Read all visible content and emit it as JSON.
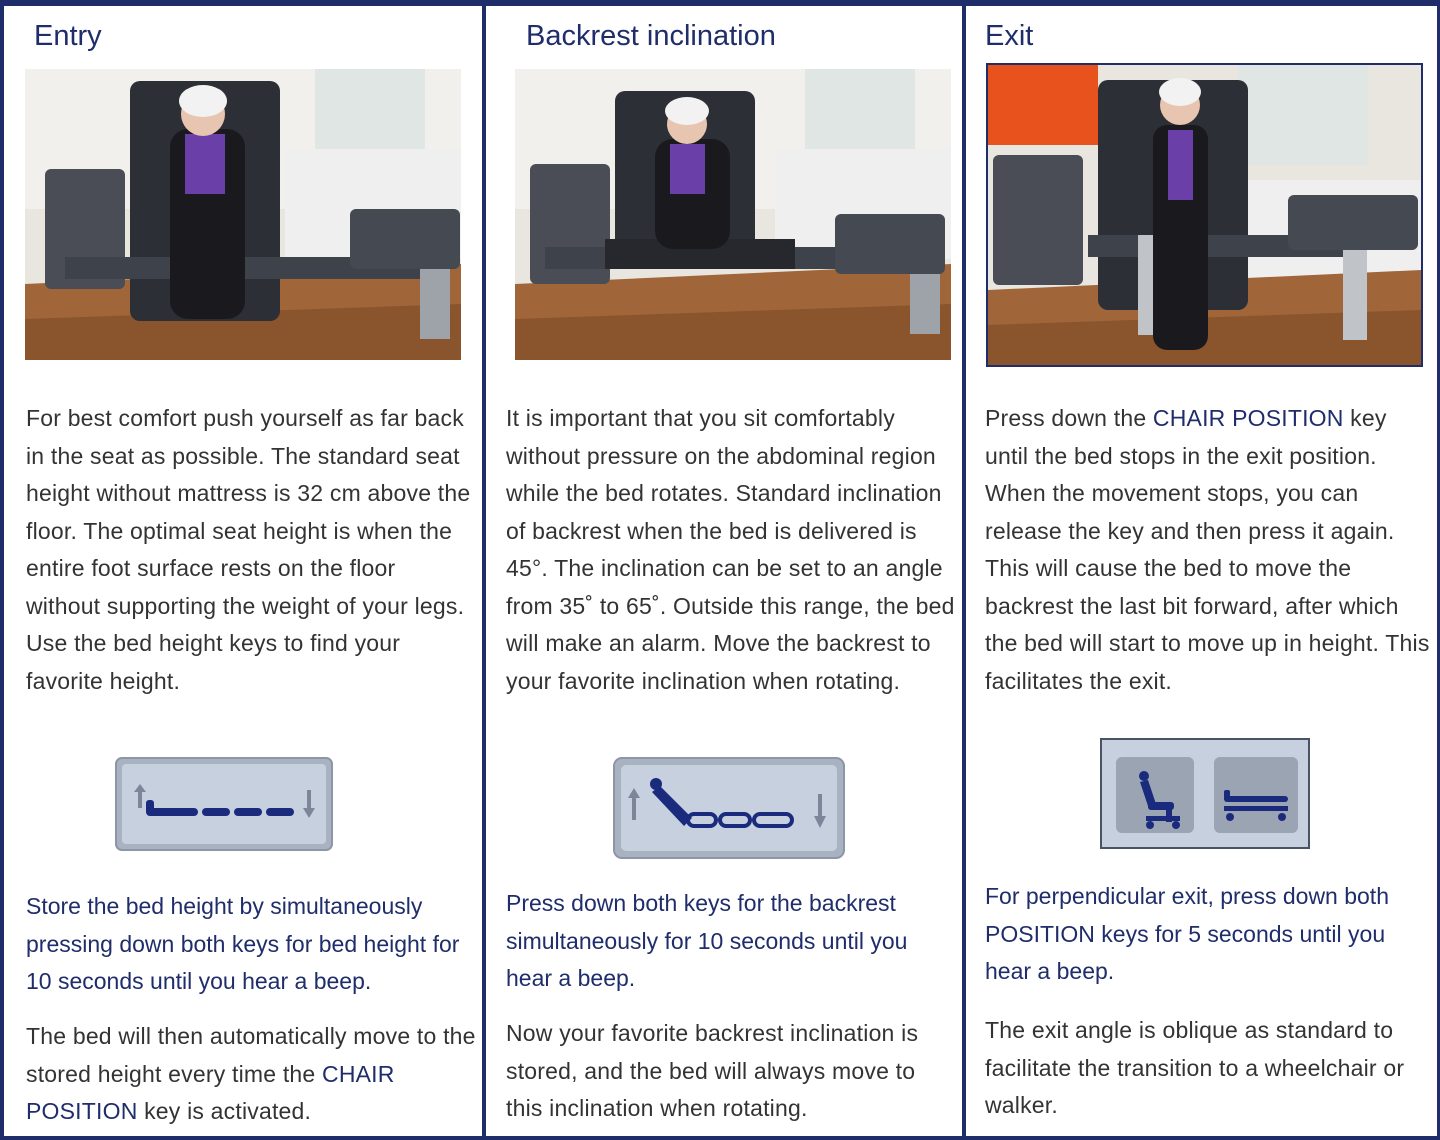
{
  "columns": [
    {
      "title": "Entry",
      "body": "For best comfort push yourself as far back in the seat as possible. The standard seat height without mattress is 32 cm above the floor. The optimal seat height is when the entire foot surface rests on the floor without supporting the weight of your legs. Use the bed height keys to find your favorite height.",
      "keypad_icon": "bed-height-up-down-icon",
      "note": "Store the bed height by simultaneously pressing down both keys for bed height for 10 seconds until you hear a beep.",
      "footer_pre": "The bed will then automatically move to the stored height every time the ",
      "footer_key": "CHAIR POSITION",
      "footer_post": " key is activated."
    },
    {
      "title": "Backrest inclination",
      "body": "It is important that you sit comfortably without pressure on the abdominal region while the bed rotates. Standard inclination of backrest when the bed is delivered is 45°. The inclination can be set to an angle from 35˚ to 65˚. Outside this range, the bed will make an alarm. Move the backrest to your favorite inclination when rotating.",
      "keypad_icon": "backrest-up-down-icon",
      "note": "Press down both keys for the backrest simultaneously for 10 seconds until you hear a beep.",
      "footer": "Now your favorite backrest inclination is stored, and the bed will always move to this inclination when rotating."
    },
    {
      "title": "Exit",
      "body_pre": "Press down the ",
      "body_key": "CHAIR POSITION",
      "body_post": " key until the bed stops in the exit position. When the movement stops, you can release the key and then press it again. This will cause the bed to move the backrest the last bit forward, after which the bed will start to move up in height. This facilitates the exit.",
      "keypad_icons": [
        "chair-position-icon",
        "bed-position-icon"
      ],
      "note": "For perpendicular exit, press down both POSITION keys for 5 seconds until you hear a beep.",
      "footer": "The exit angle is oblique as standard to facilitate the transition to a wheelchair or walker."
    }
  ],
  "colors": {
    "border": "#1f2d6b",
    "accent_text": "#1f2d6b",
    "body_text": "#333333",
    "key_bg": "#c6d0de",
    "key_symbol": "#1a2a7c",
    "arrow": "#7b8798"
  }
}
